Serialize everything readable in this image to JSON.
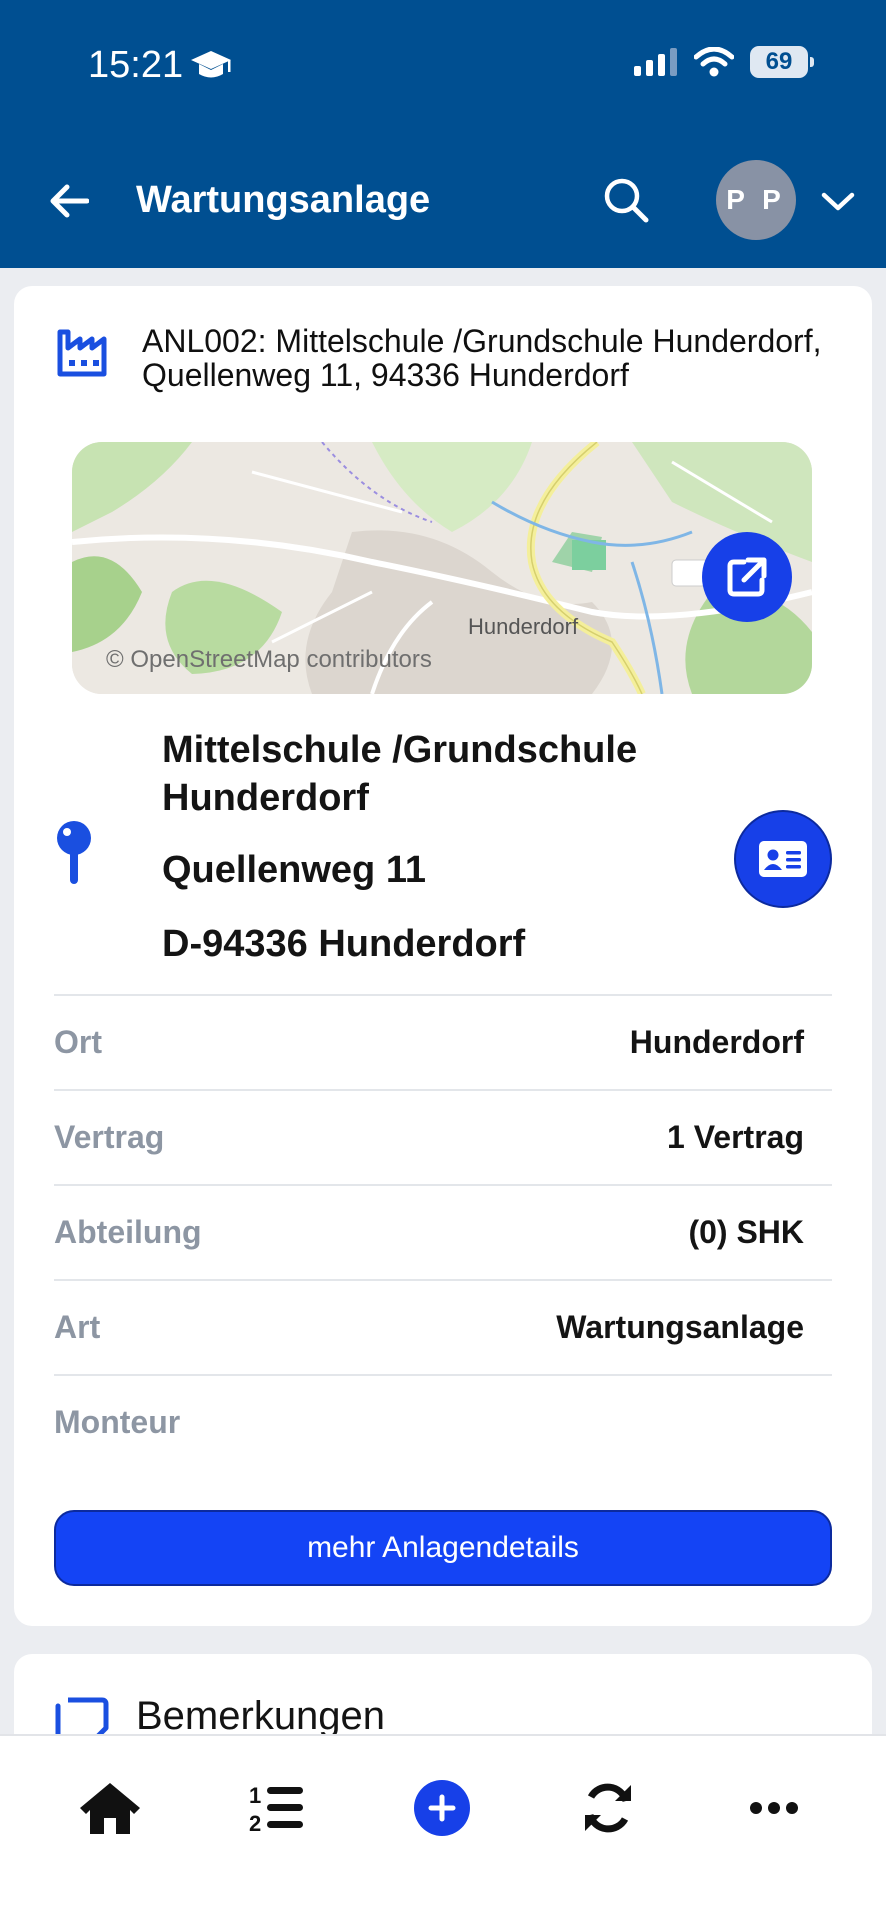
{
  "status_bar": {
    "time": "15:21",
    "battery": "69"
  },
  "header": {
    "title": "Wartungsanlage",
    "avatar_initials": "P P"
  },
  "anlage": {
    "title": "ANL002: Mittelschule /Grundschule Hunderdorf, Quellenweg 11, 94336 Hunderdorf"
  },
  "map": {
    "attribution": "© OpenStreetMap contributors",
    "place_label": "Hunderdorf"
  },
  "address": {
    "name": "Mittelschule /Grundschule Hunderdorf",
    "street": "Quellenweg 11",
    "city": "D-94336 Hunderdorf"
  },
  "rows": [
    {
      "label": "Ort",
      "value": "Hunderdorf"
    },
    {
      "label": "Vertrag",
      "value": "1 Vertrag"
    },
    {
      "label": "Abteilung",
      "value": "(0) SHK"
    },
    {
      "label": "Art",
      "value": "Wartungsanlage"
    },
    {
      "label": "Monteur",
      "value": ""
    }
  ],
  "details_button": "mehr Anlagendetails",
  "notes": {
    "title": "Bemerkungen"
  },
  "icons": {
    "status": [
      "graduation-cap-icon",
      "signal-icon",
      "wifi-icon",
      "battery-icon"
    ],
    "header": [
      "back-arrow-icon",
      "search-icon",
      "chevron-down-icon"
    ],
    "content": [
      "factory-icon",
      "external-link-icon",
      "map-pin-icon",
      "contact-card-icon",
      "notes-icon"
    ],
    "nav": [
      "home-icon",
      "numbered-list-icon",
      "add-icon",
      "sync-icon",
      "more-icon"
    ]
  },
  "colors": {
    "header_bg": "#004f91",
    "accent": "#1740e8",
    "button": "#1444f5",
    "label_gray": "#8d96a3",
    "page_bg": "#ebedf1"
  }
}
